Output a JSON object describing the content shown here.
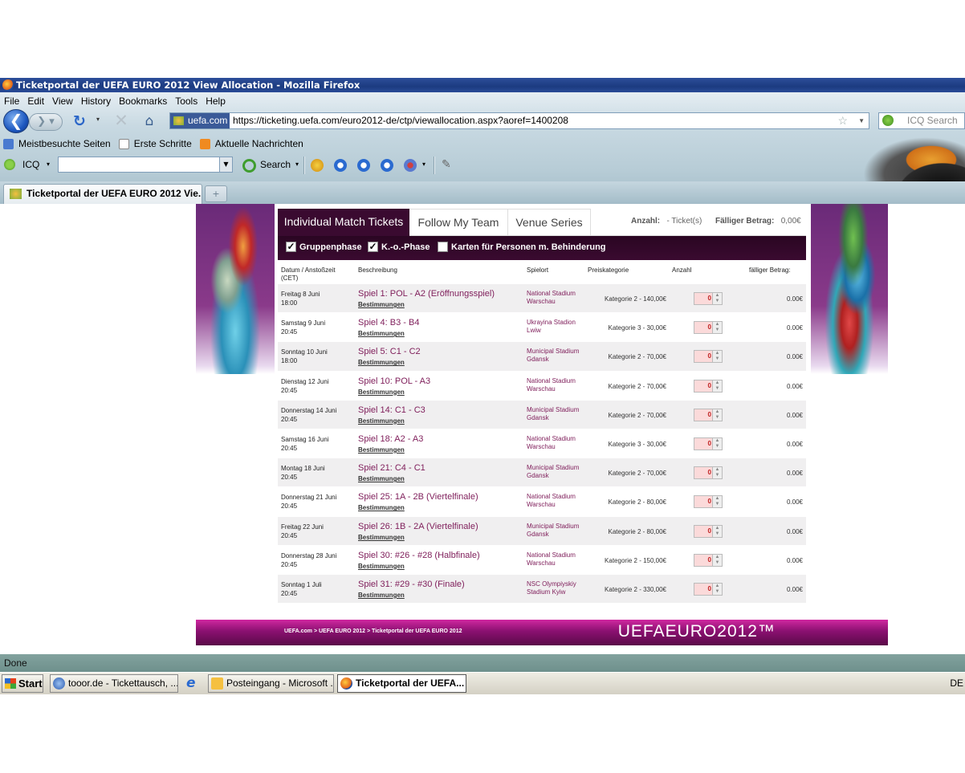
{
  "window": {
    "title": "Ticketportal der UEFA EURO 2012 View Allocation - Mozilla Firefox"
  },
  "menu": [
    "File",
    "Edit",
    "View",
    "History",
    "Bookmarks",
    "Tools",
    "Help"
  ],
  "navbar": {
    "site_label": "uefa.com",
    "url": "https://ticketing.uefa.com/euro2012-de/ctp/viewallocation.aspx?aoref=1400208",
    "search_placeholder": "ICQ Search"
  },
  "bookmarks": [
    "Meistbesuchte Seiten",
    "Erste Schritte",
    "Aktuelle Nachrichten"
  ],
  "icq_toolbar": {
    "label": "ICQ",
    "search_label": "Search"
  },
  "tab": {
    "title": "Ticketportal der UEFA EURO 2012 Vie..."
  },
  "portal": {
    "tabs": [
      "Individual Match Tickets",
      "Follow My Team",
      "Venue Series"
    ],
    "summary": {
      "count_label": "Anzahl:",
      "count_value": "- Ticket(s)",
      "amount_label": "Fälliger Betrag:",
      "amount_value": "0,00€"
    },
    "filters": [
      {
        "label": "Gruppenphase",
        "checked": true
      },
      {
        "label": "K.-o.-Phase",
        "checked": true
      },
      {
        "label": "Karten für Personen m. Behinderung",
        "checked": false
      }
    ],
    "columns": [
      "Datum / Anstoßzeit (CET)",
      "Beschreibung",
      "Spielort",
      "Preiskategorie",
      "Anzahl",
      "fälliger Betrag:"
    ],
    "rules_label": "Bestimmungen",
    "rows": [
      {
        "date": "Freitag 8 Juni",
        "time": "18:00",
        "match": "Spiel 1: POL - A2 (Eröffnungsspiel)",
        "venue": "National Stadium Warschau",
        "category": "Kategorie 2 - 140,00€",
        "qty": "0",
        "amount": "0.00€"
      },
      {
        "date": "Samstag 9 Juni",
        "time": "20:45",
        "match": "Spiel 4: B3 - B4",
        "venue": "Ukrayina Stadion Lwiw",
        "category": "Kategorie 3 - 30,00€",
        "qty": "0",
        "amount": "0.00€"
      },
      {
        "date": "Sonntag 10 Juni",
        "time": "18:00",
        "match": "Spiel 5: C1 - C2",
        "venue": "Municipal Stadium Gdansk",
        "category": "Kategorie 2 - 70,00€",
        "qty": "0",
        "amount": "0.00€"
      },
      {
        "date": "Dienstag 12 Juni",
        "time": "20:45",
        "match": "Spiel 10: POL - A3",
        "venue": "National Stadium Warschau",
        "category": "Kategorie 2 - 70,00€",
        "qty": "0",
        "amount": "0.00€"
      },
      {
        "date": "Donnerstag 14 Juni",
        "time": "20:45",
        "match": "Spiel 14: C1 - C3",
        "venue": "Municipal Stadium Gdansk",
        "category": "Kategorie 2 - 70,00€",
        "qty": "0",
        "amount": "0.00€"
      },
      {
        "date": "Samstag 16 Juni",
        "time": "20:45",
        "match": "Spiel 18: A2 - A3",
        "venue": "National Stadium Warschau",
        "category": "Kategorie 3 - 30,00€",
        "qty": "0",
        "amount": "0.00€"
      },
      {
        "date": "Montag 18 Juni",
        "time": "20:45",
        "match": "Spiel 21: C4 - C1",
        "venue": "Municipal Stadium Gdansk",
        "category": "Kategorie 2 - 70,00€",
        "qty": "0",
        "amount": "0.00€"
      },
      {
        "date": "Donnerstag 21 Juni",
        "time": "20:45",
        "match": "Spiel 25: 1A - 2B (Viertelfinale)",
        "venue": "National Stadium Warschau",
        "category": "Kategorie 2 - 80,00€",
        "qty": "0",
        "amount": "0.00€"
      },
      {
        "date": "Freitag 22 Juni",
        "time": "20:45",
        "match": "Spiel 26: 1B - 2A (Viertelfinale)",
        "venue": "Municipal Stadium Gdansk",
        "category": "Kategorie 2 - 80,00€",
        "qty": "0",
        "amount": "0.00€"
      },
      {
        "date": "Donnerstag 28 Juni",
        "time": "20:45",
        "match": "Spiel 30: #26 - #28 (Halbfinale)",
        "venue": "National Stadium Warschau",
        "category": "Kategorie 2 - 150,00€",
        "qty": "0",
        "amount": "0.00€"
      },
      {
        "date": "Sonntag 1 Juli",
        "time": "20:45",
        "match": "Spiel 31: #29 - #30 (Finale)",
        "venue": "NSC Olympiyskiy Stadium Kyiw",
        "category": "Kategorie 2 - 330,00€",
        "qty": "0",
        "amount": "0.00€"
      }
    ],
    "footer": {
      "breadcrumb": "UEFA.com > UEFA EURO 2012 > Ticketportal der UEFA EURO 2012",
      "logo": "UEFAEURO2012™"
    }
  },
  "status": "Done",
  "taskbar": {
    "start": "Start",
    "tasks": [
      "tooor.de - Tickettausch, ...",
      "Posteingang - Microsoft ...",
      "Ticketportal der UEFA..."
    ],
    "lang": "DE"
  }
}
